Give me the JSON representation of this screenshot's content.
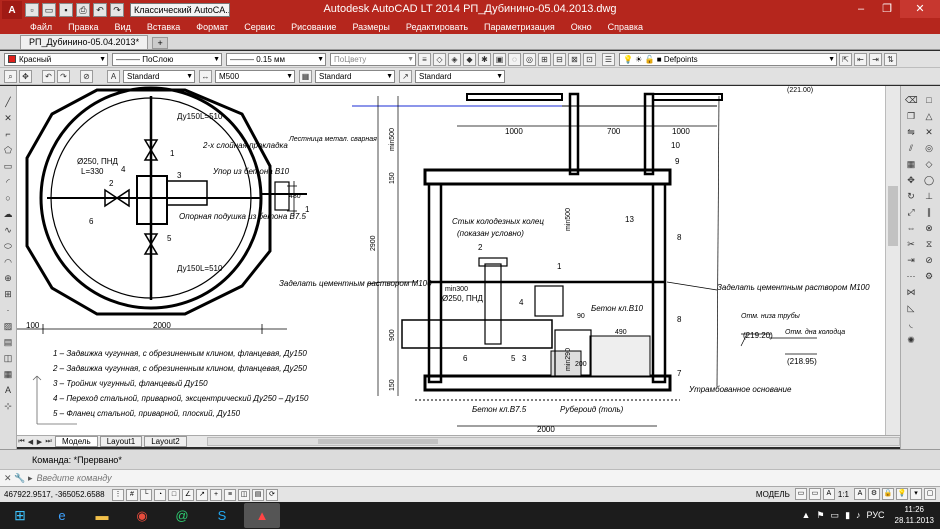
{
  "window": {
    "title": "Autodesk AutoCAD LT 2014   РП_Дубинино-05.04.2013.dwg",
    "workspace": "Классический AutoCA...",
    "app_logo": "A",
    "minimize_icon": "minimize-icon",
    "maximize_icon": "maximize-icon",
    "close_icon": "close-icon"
  },
  "menu": [
    "Файл",
    "Правка",
    "Вид",
    "Вставка",
    "Формат",
    "Сервис",
    "Рисование",
    "Размеры",
    "Редактировать",
    "Параметризация",
    "Окно",
    "Справка"
  ],
  "doc_tab": {
    "label": "РП_Дубинино-05.04.2013*"
  },
  "properties_toolbar": {
    "color": "Красный",
    "color_swatch": "#e0201b",
    "linetype": "ПоСлою",
    "lineweight": "0.15 мм",
    "plotstyle": "ПоЦвету",
    "layer": "Defpoints"
  },
  "styles_toolbar": {
    "text_style": "Standard",
    "dim_style": "M500",
    "table_style": "Standard",
    "mleader_style": "Standard"
  },
  "layout_tabs": [
    "Модель",
    "Layout1",
    "Layout2"
  ],
  "command": {
    "history": "Команда: *Прервано*",
    "placeholder": "Введите команду"
  },
  "status": {
    "coordinates": "467922.9517, -365052.6588",
    "space": "МОДЕЛЬ",
    "scale": "1:1"
  },
  "taskbar": {
    "language": "РУС",
    "time": "11:26",
    "date": "28.11.2013",
    "apps": [
      "ie-icon",
      "explorer-icon",
      "chrome-icon",
      "mail-agent-icon",
      "skype-icon",
      "autocad-icon"
    ]
  },
  "drawing": {
    "plan": {
      "labels": {
        "valve_top": "Ду150L=510",
        "valve_bottom": "Ду150L=510",
        "pipe": "Ø250, ПНД",
        "pipe_len": "L=330",
        "gasket": "2-х слойная прокладка",
        "stop": "Упор из бетона В10",
        "ladder": "Лестница метал. сварная",
        "pad": "Опорная подушка из бетона В7.5",
        "dim_480": "480",
        "dim_2000": "2000",
        "dim_100": "100"
      },
      "callouts": [
        "1",
        "2",
        "3",
        "4",
        "5",
        "6",
        "1"
      ]
    },
    "legend": [
      "1 – Задвижка чугунная, с обрезиненным клином, фланцевая, Ду150",
      "2 – Задвижка чугунная, с обрезиненным клином, фланцевая, Ду250",
      "3 – Тройник чугунный, фланцевый Ду150",
      "4 – Переход стальной, приварной, эксцентрический Ду250 – Ду150",
      "5 – Фланец стальной, приварной, плоский, Ду150"
    ],
    "section": {
      "labels": {
        "joint": "Стык колодезных колец",
        "joint_note": "(показан условно)",
        "seal_left": "Заделать цементным раствором М100",
        "seal_right": "Заделать цементным раствором М100",
        "pipe": "Ø250, ПНД",
        "min300": "min300",
        "concrete_b10": "Бетон кл.В10",
        "concrete_b75": "Бетон кл.В7.5",
        "ruberoid": "Рубероид (толь)",
        "base": "Утрамбованное основание",
        "pipe_mark_title": "Отм. низа трубы",
        "pipe_mark": "(219.20)",
        "well_mark_title": "Отм. дна колодца",
        "well_mark": "(218.95)",
        "dim_1000_a": "1000",
        "dim_700": "700",
        "dim_1000_b": "1000",
        "dim_2000": "2000",
        "dim_2900": "2900",
        "dim_150_a": "150",
        "dim_150_b": "150",
        "dim_900": "900",
        "min500_a": "min500",
        "min500_b": "min500",
        "dim_200": "200",
        "dim_490": "490",
        "dim_90": "90",
        "dim_min290": "min290",
        "top_mark": "(221.00)"
      },
      "callouts": [
        "10",
        "9",
        "13",
        "8",
        "8",
        "7",
        "2",
        "1",
        "4",
        "5",
        "3",
        "6"
      ]
    }
  }
}
